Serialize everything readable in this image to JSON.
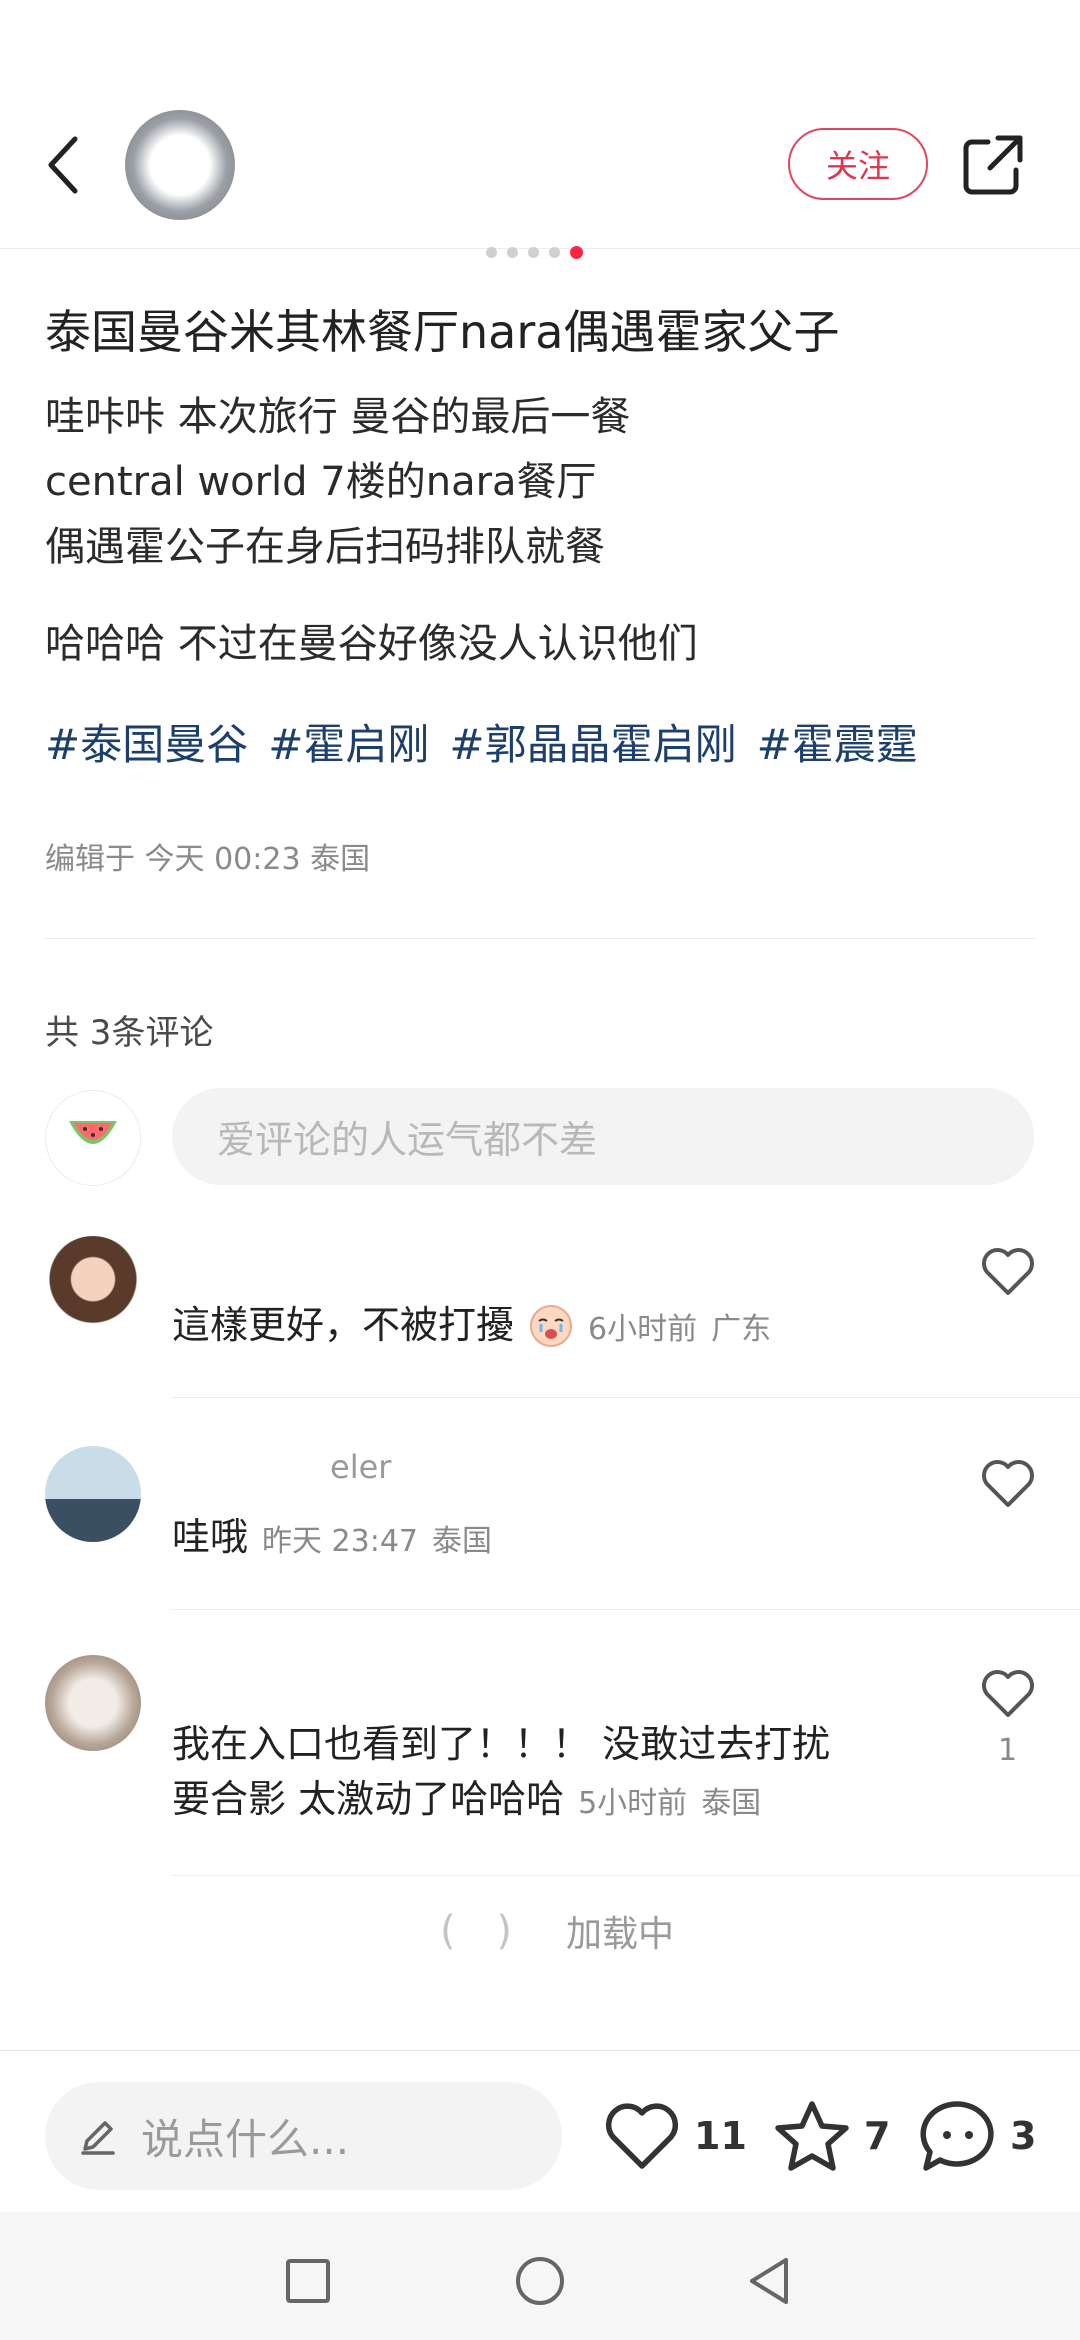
{
  "header": {
    "follow_label": "关注"
  },
  "post": {
    "title": "泰国曼谷米其林餐厅nara偶遇霍家父子",
    "body_lines": [
      "哇咔咔 本次旅行 曼谷的最后一餐",
      "central world 7楼的nara餐厅",
      "偶遇霍公子在身后扫码排队就餐"
    ],
    "body_line_4": "哈哈哈 不过在曼谷好像没人认识他们",
    "tags": [
      "#泰国曼谷",
      "#霍启刚",
      "#郭晶晶霍启刚",
      "#霍震霆"
    ],
    "meta": "编辑于 今天 00:23 泰国"
  },
  "comments_section": {
    "count_label": "共 3条评论",
    "input_placeholder": "爱评论的人运气都不差",
    "loading_label": "加载中"
  },
  "comments": [
    {
      "name": "",
      "text": "這樣更好，不被打擾",
      "time": "6小时前",
      "location": "广东",
      "likes": ""
    },
    {
      "name": "eler",
      "text": "哇哦",
      "time": "昨天 23:47",
      "location": "泰国",
      "likes": ""
    },
    {
      "name": "",
      "text_line1": "我在入口也看到了！！！ 没敢过去打扰",
      "text_line2": "要合影 太激动了哈哈哈",
      "time": "5小时前",
      "location": "泰国",
      "likes": "1"
    }
  ],
  "bottom_bar": {
    "input_placeholder": "说点什么...",
    "likes": "11",
    "collects": "7",
    "comments": "3"
  },
  "colors": {
    "accent": "#ff2442",
    "follow": "#e0344f",
    "tag": "#1d3f6e"
  }
}
